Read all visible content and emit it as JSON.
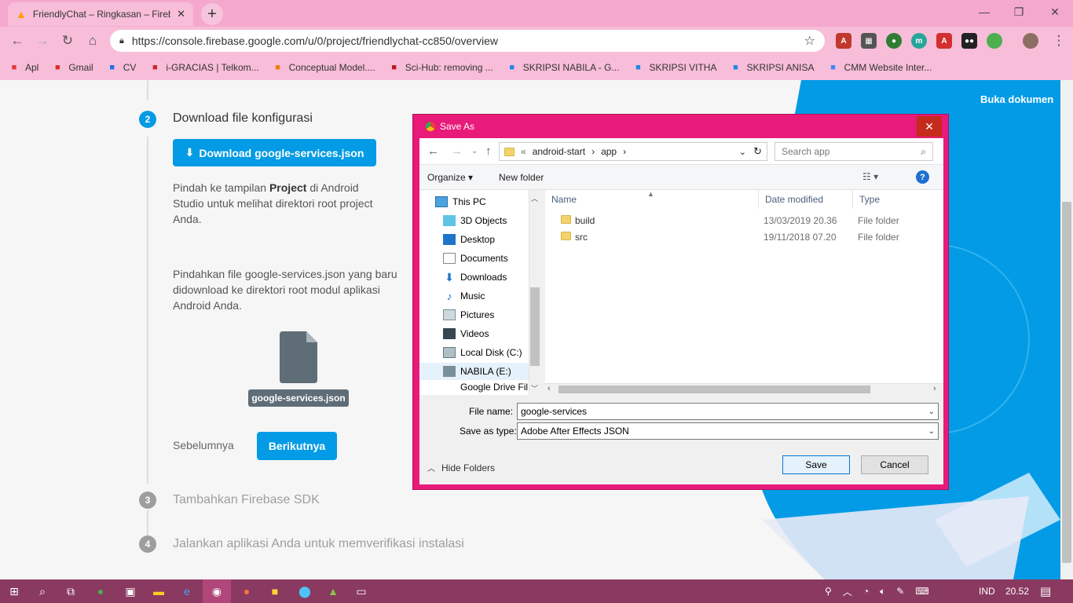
{
  "browser": {
    "tab_title": "FriendlyChat – Ringkasan – Fireb",
    "url": "https://console.firebase.google.com/u/0/project/friendlychat-cc850/overview",
    "bookmarks": [
      {
        "label": "Apl",
        "icon": "apps-icon",
        "color": "#e53935"
      },
      {
        "label": "Gmail",
        "icon": "gmail-icon",
        "color": "#d93025"
      },
      {
        "label": "CV",
        "icon": "zotero-icon",
        "color": "#1a73e8"
      },
      {
        "label": "i-GRACIAS | Telkom...",
        "icon": "igracias-icon",
        "color": "#c62828"
      },
      {
        "label": "Conceptual Model....",
        "icon": "conceptual-icon",
        "color": "#f57c00"
      },
      {
        "label": "Sci-Hub: removing ...",
        "icon": "scihub-icon",
        "color": "#b71c1c"
      },
      {
        "label": "SKRIPSI NABILA - G...",
        "icon": "drive-icon",
        "color": "#1e88e5"
      },
      {
        "label": "SKRIPSI VITHA",
        "icon": "drive-icon",
        "color": "#1e88e5"
      },
      {
        "label": "SKRIPSI ANISA",
        "icon": "drive-icon",
        "color": "#1e88e5"
      },
      {
        "label": "CMM Website Inter...",
        "icon": "google-icon",
        "color": "#4285f4"
      }
    ]
  },
  "page": {
    "buka_dokumen": "Buka dokumen",
    "step2_num": "2",
    "step2_title": "Download file konfigurasi",
    "download_btn": "Download google-services.json",
    "para1_a": "Pindah ke tampilan ",
    "para1_b": "Project",
    "para1_c": " di Android Studio untuk melihat direktori root project Anda.",
    "para2": "Pindahkan file google-services.json yang baru didownload ke direktori root modul aplikasi Android Anda.",
    "file_label": "google-services.json",
    "prev": "Sebelumnya",
    "next": "Berikutnya",
    "step3_num": "3",
    "step3_title": "Tambahkan Firebase SDK",
    "step4_num": "4",
    "step4_title": "Jalankan aplikasi Anda untuk memverifikasi instalasi",
    "accent": "#039be5"
  },
  "dialog": {
    "title": "Save As",
    "breadcrumb": [
      "«",
      "android-start",
      "app"
    ],
    "search_placeholder": "Search app",
    "organize": "Organize",
    "new_folder": "New folder",
    "nav_items": [
      "This PC",
      "3D Objects",
      "Desktop",
      "Documents",
      "Downloads",
      "Music",
      "Pictures",
      "Videos",
      "Local Disk (C:)",
      "NABILA (E:)",
      "Google Drive Fil"
    ],
    "columns": [
      "Name",
      "Date modified",
      "Type"
    ],
    "files": [
      {
        "name": "build",
        "date": "13/03/2019 20.36",
        "type": "File folder"
      },
      {
        "name": "src",
        "date": "19/11/2018 07.20",
        "type": "File folder"
      }
    ],
    "file_name_label": "File name:",
    "file_name_value": "google-services",
    "save_type_label": "Save as type:",
    "save_type_value": "Adobe After Effects JSON",
    "hide_folders": "Hide Folders",
    "save": "Save",
    "cancel": "Cancel",
    "frame_color": "#e81a7a"
  },
  "taskbar": {
    "lang": "IND",
    "time": "20.52"
  }
}
